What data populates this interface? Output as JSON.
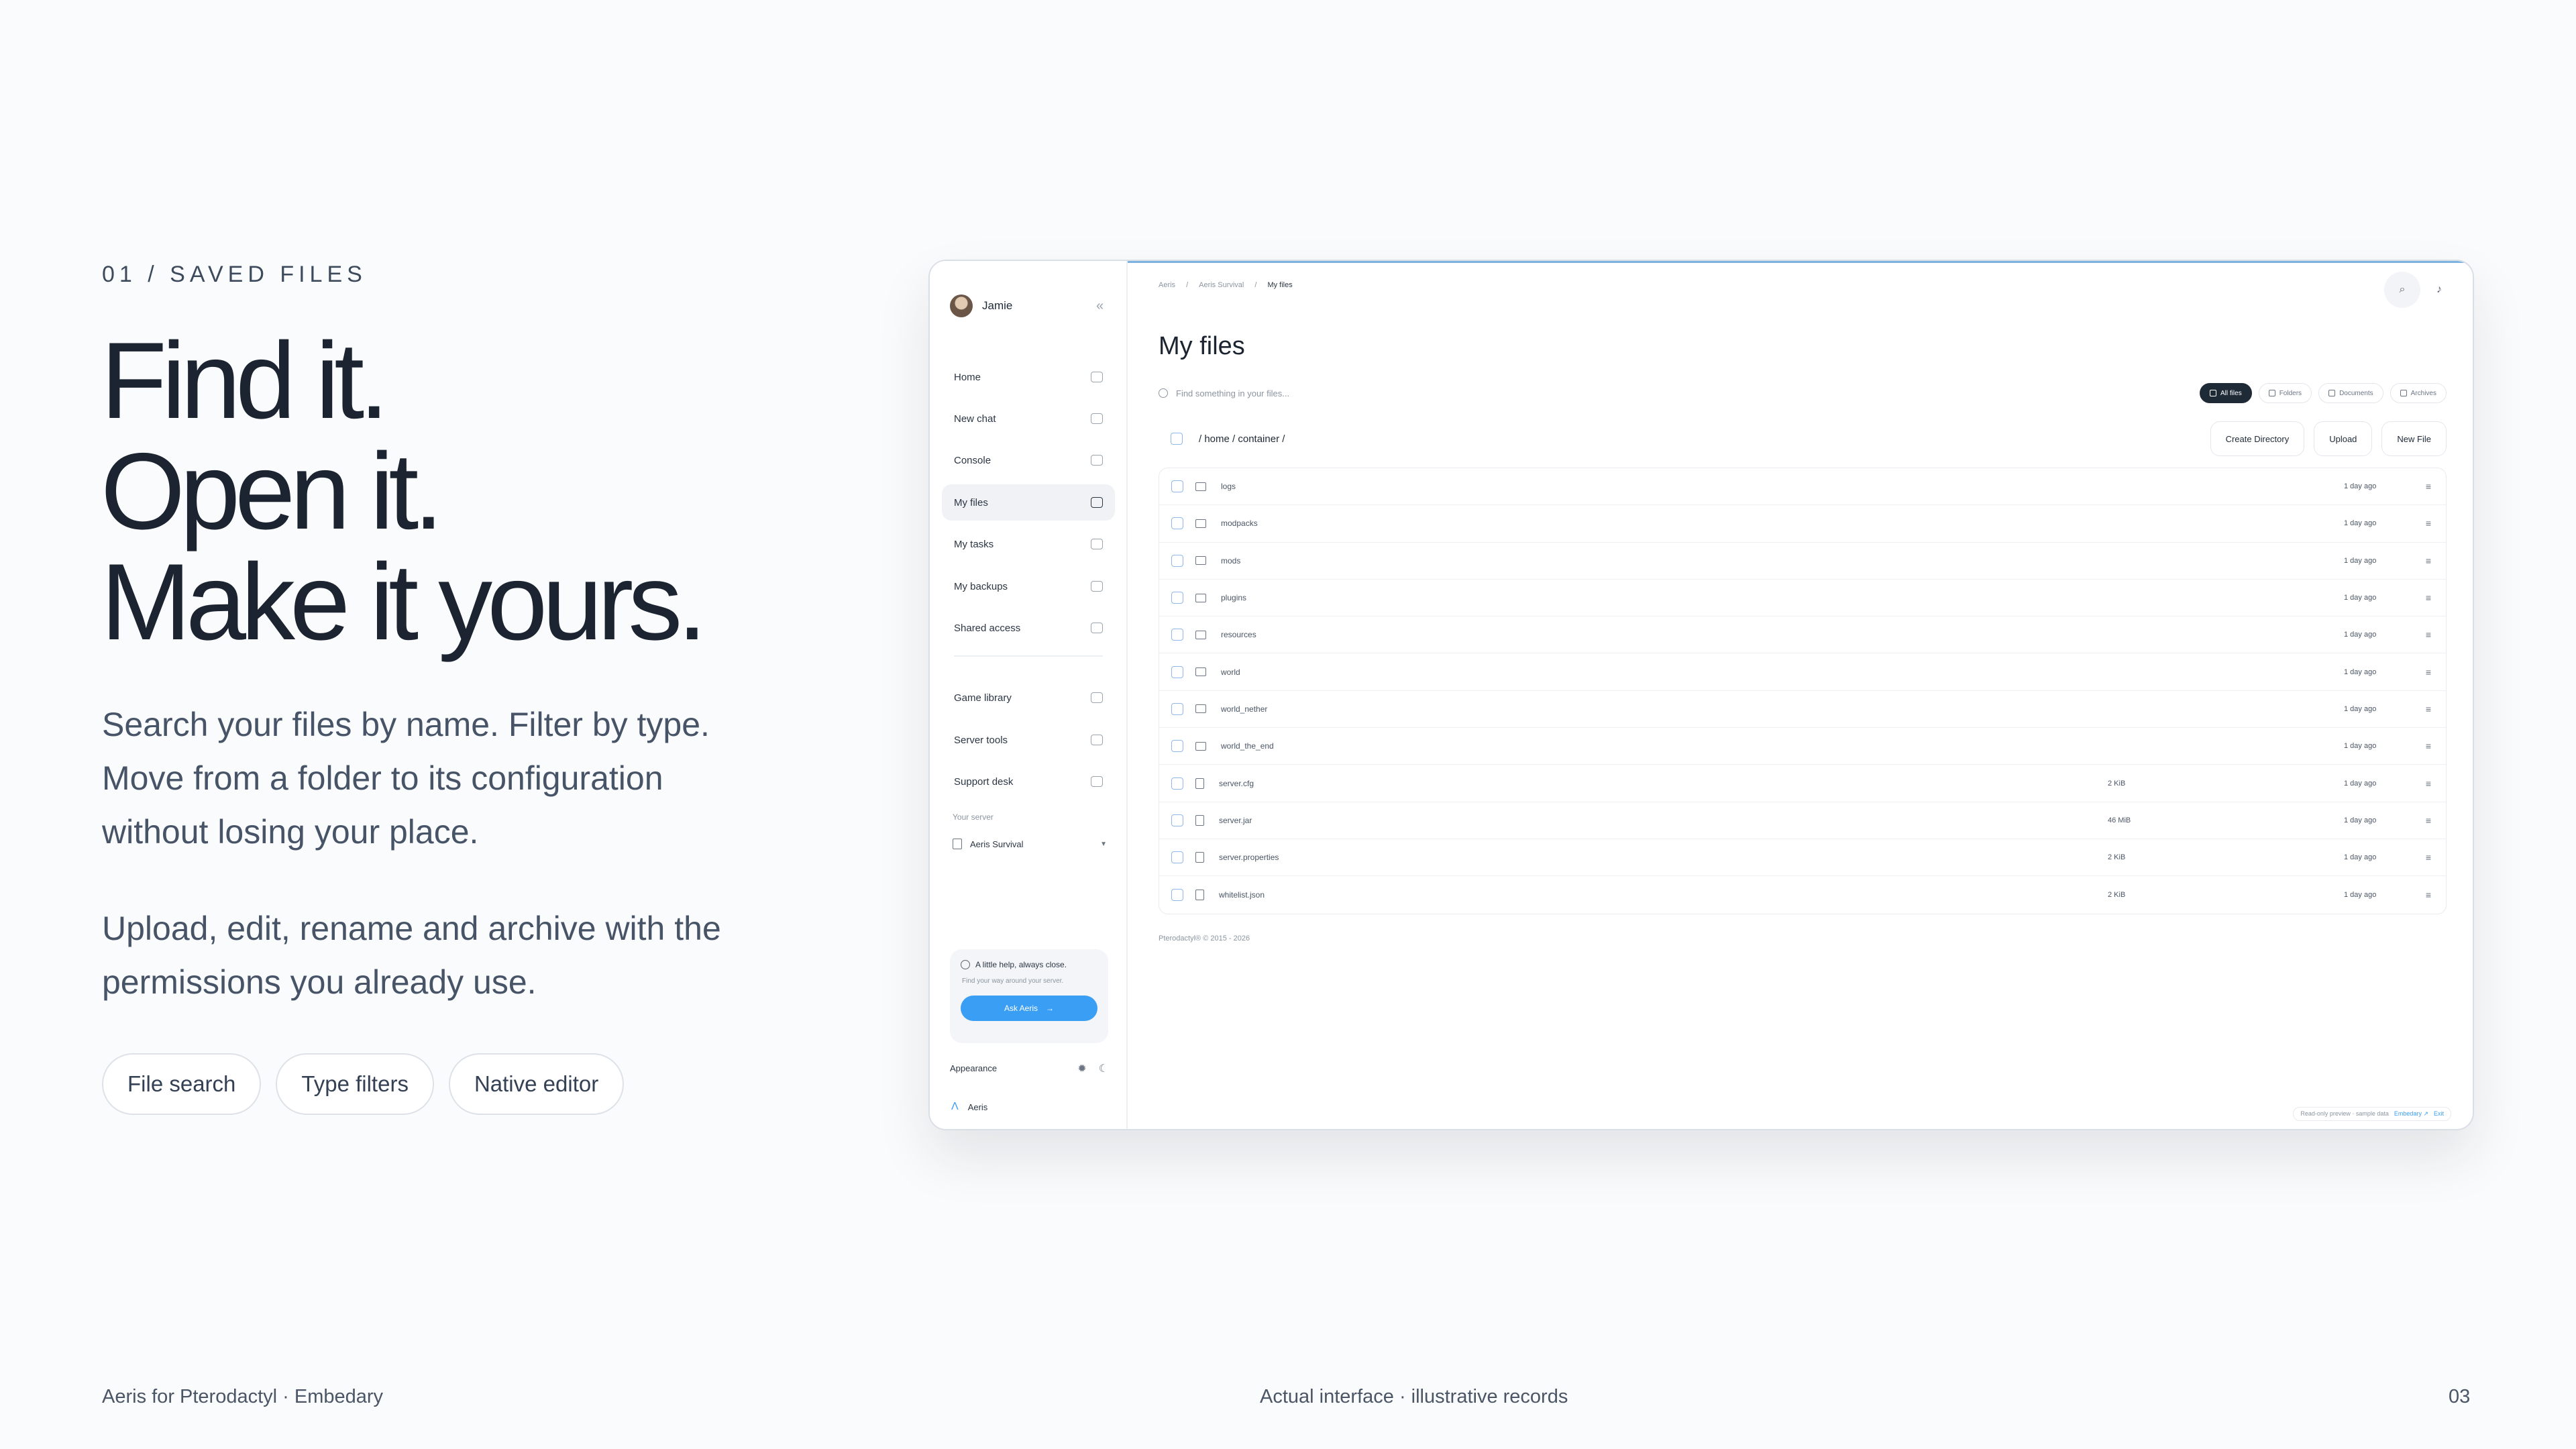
{
  "slide": {
    "eyebrow": "01 / SAVED FILES",
    "headline": [
      "Find it.",
      "Open it.",
      "Make it yours."
    ],
    "paragraph1": "Search your files by name. Filter by type. Move from a folder to its configuration without losing your place.",
    "paragraph2": "Upload, edit, rename and archive with the permissions you already use.",
    "pills": [
      "File search",
      "Type filters",
      "Native editor"
    ],
    "footer_left": "Aeris for Pterodactyl · Embedary",
    "footer_center": "Actual interface · illustrative records",
    "footer_right": "03"
  },
  "app": {
    "user_name": "Jamie",
    "nav": [
      {
        "label": "Home",
        "icon": "home-icon"
      },
      {
        "label": "New chat",
        "icon": "chat-icon"
      },
      {
        "label": "Console",
        "icon": "console-icon"
      },
      {
        "label": "My files",
        "icon": "folder-icon",
        "active": true
      },
      {
        "label": "My tasks",
        "icon": "calendar-icon"
      },
      {
        "label": "My backups",
        "icon": "archive-icon"
      },
      {
        "label": "Shared access",
        "icon": "share-icon"
      },
      {
        "label": "Game library",
        "icon": "gamepad-icon"
      },
      {
        "label": "Server tools",
        "icon": "tools-icon"
      },
      {
        "label": "Support desk",
        "icon": "support-icon"
      }
    ],
    "server_label": "Your server",
    "server_name": "Aeris Survival",
    "help_title": "A little help, always close.",
    "help_sub": "Find your way around your server.",
    "ask_button": "Ask Aeris",
    "appearance_label": "Appearance",
    "brand_name": "Aeris",
    "breadcrumbs": [
      "Aeris",
      "Aeris Survival",
      "My files"
    ],
    "page_title": "My files",
    "search_placeholder": "Find something in your files...",
    "filters": [
      "All files",
      "Folders",
      "Documents",
      "Archives"
    ],
    "path": "/ home / container /",
    "actions": [
      "Create Directory",
      "Upload",
      "New File"
    ],
    "files": [
      {
        "name": "logs",
        "type": "folder",
        "size": "",
        "modified": "1 day ago"
      },
      {
        "name": "modpacks",
        "type": "folder",
        "size": "",
        "modified": "1 day ago"
      },
      {
        "name": "mods",
        "type": "folder",
        "size": "",
        "modified": "1 day ago"
      },
      {
        "name": "plugins",
        "type": "folder",
        "size": "",
        "modified": "1 day ago"
      },
      {
        "name": "resources",
        "type": "folder",
        "size": "",
        "modified": "1 day ago"
      },
      {
        "name": "world",
        "type": "folder",
        "size": "",
        "modified": "1 day ago"
      },
      {
        "name": "world_nether",
        "type": "folder",
        "size": "",
        "modified": "1 day ago"
      },
      {
        "name": "world_the_end",
        "type": "folder",
        "size": "",
        "modified": "1 day ago"
      },
      {
        "name": "server.cfg",
        "type": "file",
        "size": "2 KiB",
        "modified": "1 day ago"
      },
      {
        "name": "server.jar",
        "type": "file",
        "size": "46 MiB",
        "modified": "1 day ago"
      },
      {
        "name": "server.properties",
        "type": "file",
        "size": "2 KiB",
        "modified": "1 day ago"
      },
      {
        "name": "whitelist.json",
        "type": "file",
        "size": "2 KiB",
        "modified": "1 day ago"
      }
    ],
    "copyright": "Pterodactyl® © 2015 - 2026",
    "preview_note": "Read-only preview · sample data",
    "preview_link": "Embedary ↗",
    "preview_exit": "Exit",
    "colors": {
      "accent": "#3b9ef5",
      "active_chip": "#1f2a37"
    }
  }
}
